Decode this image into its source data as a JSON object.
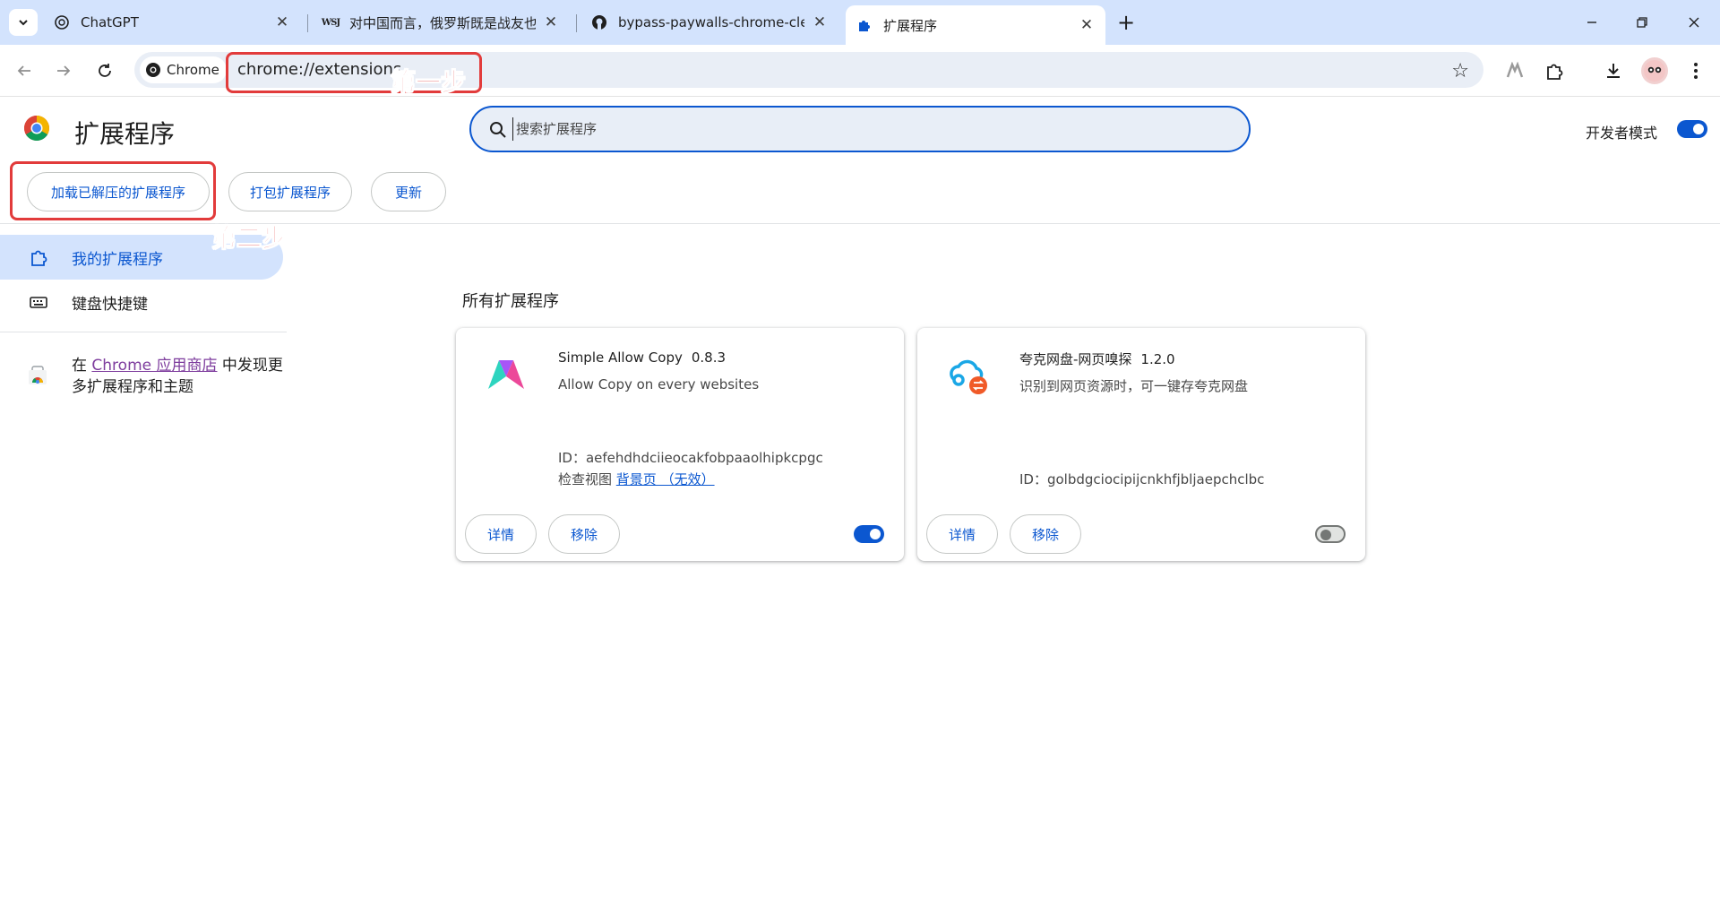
{
  "browser": {
    "tabs": [
      {
        "title": "ChatGPT",
        "favicon": "chatgpt-icon"
      },
      {
        "title": "对中国而言，俄罗斯既是战友也",
        "favicon": "wsj-icon"
      },
      {
        "title": "bypass-paywalls-chrome-clea",
        "favicon": "github-icon"
      },
      {
        "title": "扩展程序",
        "favicon": "puzzle-icon",
        "active": true
      }
    ],
    "wsj_favicon_text": "WSJ",
    "chip_label": "Chrome",
    "url": "chrome://extensions"
  },
  "header": {
    "title": "扩展程序",
    "search_placeholder": "搜索扩展程序",
    "dev_mode_label": "开发者模式",
    "dev_mode_on": true,
    "buttons": {
      "load_unpacked": "加载已解压的扩展程序",
      "pack": "打包扩展程序",
      "update": "更新"
    }
  },
  "sidebar": {
    "items": [
      {
        "label": "我的扩展程序",
        "active": true
      },
      {
        "label": "键盘快捷键",
        "active": false
      }
    ],
    "promo_prefix": "在 ",
    "promo_link": "Chrome 应用商店",
    "promo_suffix": " 中发现更多扩展程序和主题"
  },
  "main": {
    "section_title": "所有扩展程序",
    "extensions": [
      {
        "name": "Simple Allow Copy",
        "version": "0.8.3",
        "description": "Allow Copy on every websites",
        "id": "ID：aefehdhdciieocakfobpaaolhipkcpgc",
        "inspect_label": "检查视图",
        "inspect_link": "背景页 （无效）",
        "details": "详情",
        "remove": "移除",
        "enabled": true
      },
      {
        "name": "夸克网盘-网页嗅探",
        "version": "1.2.0",
        "description": "识别到网页资源时，可一键存夸克网盘",
        "id": "ID：golbdgciocipijcnkhfjbljaepchclbc",
        "details": "详情",
        "remove": "移除",
        "enabled": false
      }
    ]
  },
  "annotations": {
    "step1": "第一步",
    "step2": "第二步"
  },
  "colors": {
    "accent": "#0b57d0",
    "tabstrip": "#d3e3fd",
    "annotation": "#e23b3b"
  }
}
